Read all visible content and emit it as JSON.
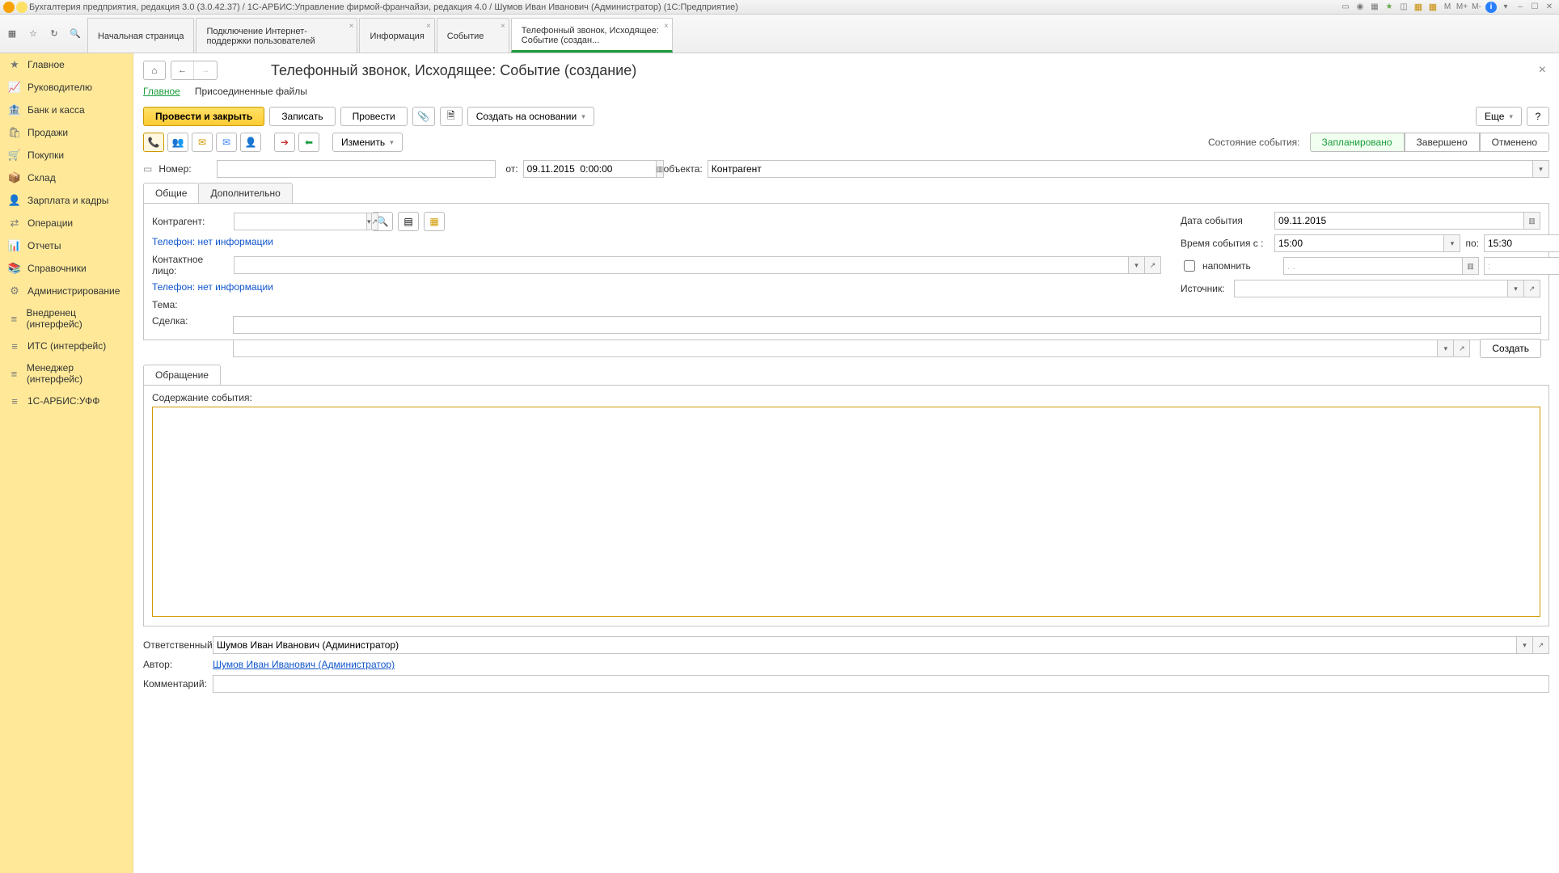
{
  "titlebar": {
    "text": "Бухгалтерия предприятия, редакция 3.0 (3.0.42.37) / 1С-АРБИС:Управление фирмой-франчайзи, редакция 4.0 / Шумов Иван Иванович (Администратор)  (1C:Предприятие)",
    "m": "M",
    "mplus": "M+",
    "mminus": "M-"
  },
  "tabs": [
    {
      "label": "Начальная страница"
    },
    {
      "label": "Подключение Интернет-поддержки пользователей"
    },
    {
      "label": "Информация"
    },
    {
      "label": "Событие"
    },
    {
      "label": "Телефонный звонок, Исходящее: Событие (создан..."
    }
  ],
  "sidebar": {
    "items": [
      {
        "label": "Главное",
        "icon": "★"
      },
      {
        "label": "Руководителю",
        "icon": "📈"
      },
      {
        "label": "Банк и касса",
        "icon": "🏦"
      },
      {
        "label": "Продажи",
        "icon": "🛍"
      },
      {
        "label": "Покупки",
        "icon": "🛒"
      },
      {
        "label": "Склад",
        "icon": "📦"
      },
      {
        "label": "Зарплата и кадры",
        "icon": "👤"
      },
      {
        "label": "Операции",
        "icon": "⇄"
      },
      {
        "label": "Отчеты",
        "icon": "📊"
      },
      {
        "label": "Справочники",
        "icon": "📚"
      },
      {
        "label": "Администрирование",
        "icon": "⚙"
      },
      {
        "label": "Внедренец (интерфейс)",
        "icon": "≡"
      },
      {
        "label": "ИТС (интерфейс)",
        "icon": "≡"
      },
      {
        "label": "Менеджер (интерфейс)",
        "icon": "≡"
      },
      {
        "label": "1С-АРБИС:УФФ",
        "icon": "≡"
      }
    ]
  },
  "page": {
    "title": "Телефонный звонок, Исходящее: Событие (создание)",
    "subnav_main": "Главное",
    "subnav_files": "Присоединенные файлы",
    "btn_post_close": "Провести и закрыть",
    "btn_save": "Записать",
    "btn_post": "Провести",
    "btn_create_basis": "Создать на основании",
    "btn_more": "Еще",
    "btn_change": "Изменить",
    "status_label": "Состояние события:",
    "status_planned": "Запланировано",
    "status_done": "Завершено",
    "status_cancel": "Отменено",
    "lbl_number": "Номер:",
    "lbl_from": "от:",
    "val_from": "09.11.2015  0:00:00",
    "lbl_objtype": "Вид объекта:",
    "val_objtype": "Контрагент",
    "tab_common": "Общие",
    "tab_extra": "Дополнительно",
    "lbl_counterparty": "Контрагент:",
    "tel_noinfo": "Телефон: нет информации",
    "lbl_contact": "Контактное лицо:",
    "lbl_subject": "Тема:",
    "lbl_deal": "Сделка:",
    "btn_create": "Создать",
    "lbl_date": "Дата события",
    "val_date": "09.11.2015",
    "lbl_time_from": "Время события с :",
    "val_time_from": "15:00",
    "lbl_time_to": "по:",
    "val_time_to": "15:30",
    "lbl_remind": "напомнить",
    "val_remind_date": ". .",
    "val_remind_time": ":",
    "lbl_source": "Источник:",
    "tab_appeal": "Обращение",
    "lbl_content": "Содержание события:",
    "lbl_responsible": "Ответственный:",
    "val_responsible": "Шумов Иван Иванович (Администратор)",
    "lbl_author": "Автор:",
    "val_author": "Шумов Иван Иванович (Администратор)",
    "lbl_comment": "Комментарий:"
  }
}
